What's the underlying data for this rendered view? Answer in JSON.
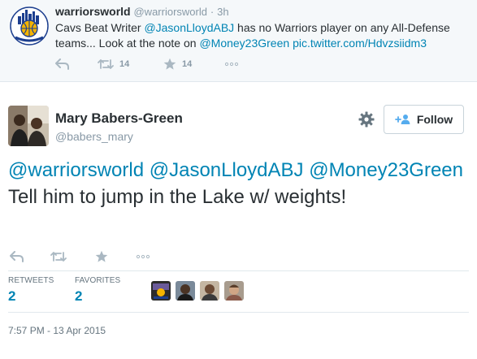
{
  "parent_tweet": {
    "name": "warriorsworld",
    "handle": "@warriorsworld",
    "separator": "·",
    "time": "3h",
    "text_parts": [
      {
        "text": "Cavs Beat Writer ",
        "link": false
      },
      {
        "text": "@JasonLloydABJ",
        "link": true
      },
      {
        "text": " has no Warriors player on any All-Defense teams... Look at the note on ",
        "link": false
      },
      {
        "text": "@Money23Green",
        "link": true
      },
      {
        "text": " ",
        "link": false
      },
      {
        "text": "pic.twitter.com/Hdvzsiidm3",
        "link": true
      }
    ],
    "retweet_count": "14",
    "favorite_count": "14",
    "avatar_icon": "warriors-world-logo-icon"
  },
  "main_tweet": {
    "name": "Mary Babers-Green",
    "handle": "@babers_mary",
    "follow_label": "Follow",
    "text_parts": [
      {
        "text": "@warriorsworld",
        "link": true
      },
      {
        "text": " ",
        "link": false
      },
      {
        "text": "@JasonLloydABJ",
        "link": true
      },
      {
        "text": " ",
        "link": false
      },
      {
        "text": "@Money23Green",
        "link": true
      },
      {
        "text": " Tell him to jump in the Lake w/ weights!",
        "link": false
      }
    ],
    "stats": {
      "retweets_label": "RETWEETS",
      "retweets_value": "2",
      "favorites_label": "FAVORITES",
      "favorites_value": "2"
    },
    "timestamp": "7:57 PM - 13 Apr 2015"
  },
  "colors": {
    "link": "#0084b4",
    "text": "#292f33",
    "muted": "#8899a6",
    "action_icon": "#aab8c2",
    "parent_bg": "#f5f8fa"
  }
}
